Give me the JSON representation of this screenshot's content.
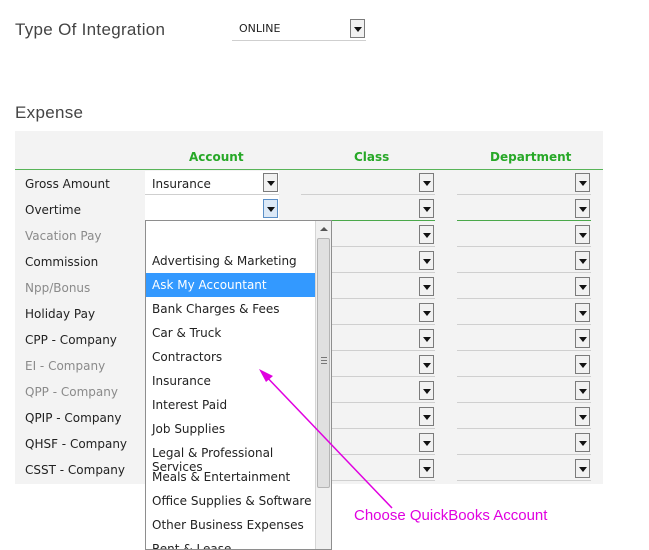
{
  "integration": {
    "label": "Type Of Integration",
    "value": "ONLINE"
  },
  "expense": {
    "title": "Expense",
    "headers": {
      "account": "Account",
      "class": "Class",
      "department": "Department"
    },
    "rows": [
      {
        "label": "Gross Amount",
        "account": "Insurance",
        "style": "dark"
      },
      {
        "label": "Overtime",
        "account": "",
        "style": "dark"
      },
      {
        "label": "Vacation Pay",
        "account": "",
        "style": "grey"
      },
      {
        "label": "Commission",
        "account": "",
        "style": "dark"
      },
      {
        "label": "Npp/Bonus",
        "account": "",
        "style": "grey"
      },
      {
        "label": "Holiday Pay",
        "account": "",
        "style": "dark"
      },
      {
        "label": "CPP - Company",
        "account": "",
        "style": "dark"
      },
      {
        "label": "EI - Company",
        "account": "",
        "style": "grey"
      },
      {
        "label": "QPP - Company",
        "account": "",
        "style": "grey"
      },
      {
        "label": "QPIP - Company",
        "account": "",
        "style": "dark"
      },
      {
        "label": "QHSF - Company",
        "account": "",
        "style": "dark"
      },
      {
        "label": "CSST - Company",
        "account": "",
        "style": "dark"
      }
    ]
  },
  "dropdown": {
    "items": [
      "",
      "Advertising & Marketing",
      "Ask My Accountant",
      "Bank Charges & Fees",
      "Car & Truck",
      "Contractors",
      "Insurance",
      "Interest Paid",
      "Job Supplies",
      "Legal & Professional Services",
      "Meals & Entertainment",
      "Office Supplies & Software",
      "Other Business Expenses",
      "Rent & Lease"
    ],
    "selected_index": 2
  },
  "callout": {
    "text": "Choose QuickBooks Account",
    "color": "#e000e0"
  }
}
